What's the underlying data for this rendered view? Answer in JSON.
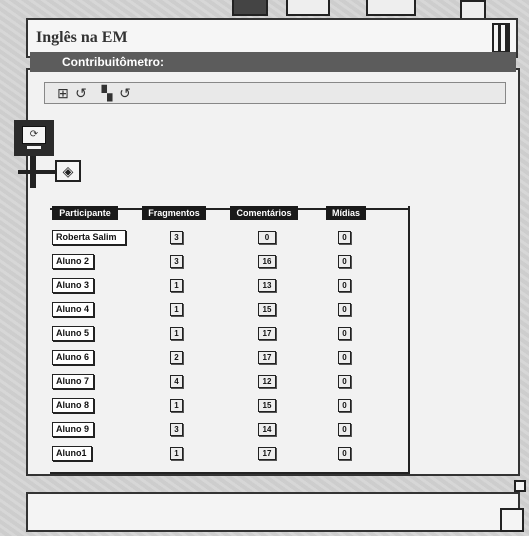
{
  "window": {
    "title": "Inglês na EM"
  },
  "toolbar": {
    "icons": [
      "table-view-icon",
      "undo-arrow-icon",
      "layout-toggle-icon",
      "undo-arrow-icon"
    ]
  },
  "widget": {
    "title": "Contribuitômetro:"
  },
  "table": {
    "columns": [
      "Participante",
      "Fragmentos",
      "Comentários",
      "Mídias"
    ],
    "rows": [
      {
        "name": "Roberta Salim",
        "fragmentos": "3",
        "comentarios": "0",
        "midias": "0"
      },
      {
        "name": "Aluno 2",
        "fragmentos": "3",
        "comentarios": "16",
        "midias": "0"
      },
      {
        "name": "Aluno 3",
        "fragmentos": "1",
        "comentarios": "13",
        "midias": "0"
      },
      {
        "name": "Aluno 4",
        "fragmentos": "1",
        "comentarios": "15",
        "midias": "0"
      },
      {
        "name": "Aluno 5",
        "fragmentos": "1",
        "comentarios": "17",
        "midias": "0"
      },
      {
        "name": "Aluno 6",
        "fragmentos": "2",
        "comentarios": "17",
        "midias": "0"
      },
      {
        "name": "Aluno 7",
        "fragmentos": "4",
        "comentarios": "12",
        "midias": "0"
      },
      {
        "name": "Aluno 8",
        "fragmentos": "1",
        "comentarios": "15",
        "midias": "0"
      },
      {
        "name": "Aluno 9",
        "fragmentos": "3",
        "comentarios": "14",
        "midias": "0"
      },
      {
        "name": "Aluno1",
        "fragmentos": "1",
        "comentarios": "17",
        "midias": "0"
      }
    ]
  },
  "colors": {
    "header_bar": "#5c5c5c",
    "column_header": "#1a1a1a",
    "panel": "#f2f2f2",
    "background": "#d4d4d4"
  }
}
